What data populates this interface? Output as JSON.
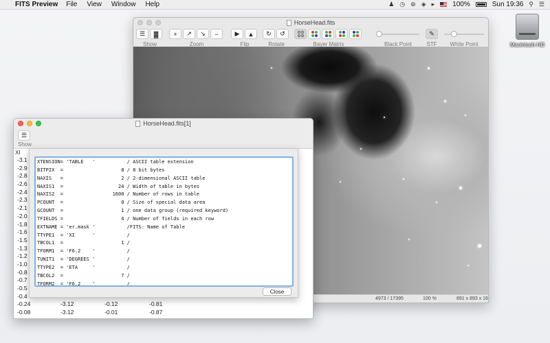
{
  "menubar": {
    "apple_glyph": "",
    "app_name": "FITS Preview",
    "items": [
      "File",
      "View",
      "Window",
      "Help"
    ],
    "battery": "100%",
    "clock": "Sun 19:36"
  },
  "desktop": {
    "disk_label": "Macintosh HD"
  },
  "main_window": {
    "title": "HorseHead.fits",
    "toolbar_labels": {
      "show": "Show",
      "zoom": "Zoom",
      "flip": "Flip",
      "rotate": "Rotate",
      "bayer_matrix": "Bayer Matrix",
      "black_point": "Black Point",
      "stf": "STF",
      "white_point": "White Point"
    },
    "black_point_level": 0.05,
    "white_point_level": 0.25,
    "status": {
      "pixel_value": "4973 / 17395",
      "zoom": "100 %",
      "dimensions": "891 x 893 x 16"
    }
  },
  "table_window": {
    "title": "HorseHead.fits[1]",
    "show_label": "Show",
    "column_header": "XI",
    "rows": [
      [
        "-3.1",
        "",
        "",
        ""
      ],
      [
        "-2.9",
        "",
        "",
        ""
      ],
      [
        "-2.8",
        "",
        "",
        ""
      ],
      [
        "-2.6",
        "",
        "",
        ""
      ],
      [
        "-2.4",
        "",
        "",
        ""
      ],
      [
        "-2.3",
        "",
        "",
        ""
      ],
      [
        "-2.1",
        "",
        "",
        ""
      ],
      [
        "-2.0",
        "",
        "",
        ""
      ],
      [
        "-1.8",
        "",
        "",
        ""
      ],
      [
        "-1.6",
        "",
        "",
        ""
      ],
      [
        "-1.5",
        "",
        "",
        ""
      ],
      [
        "-1.3",
        "",
        "",
        ""
      ],
      [
        "-1.2",
        "",
        "",
        ""
      ],
      [
        "-1.0",
        "",
        "",
        ""
      ],
      [
        "-0.8",
        "",
        "",
        ""
      ],
      [
        "-0.7",
        "",
        "",
        ""
      ],
      [
        "-0.5",
        "",
        "",
        ""
      ],
      [
        "-0.4",
        "",
        "",
        ""
      ],
      [
        "-0.24",
        "-3.12",
        "-0.12",
        "-0.81"
      ],
      [
        "-0.08",
        "-3.12",
        "-0.01",
        "-0.87"
      ]
    ]
  },
  "header_sheet": {
    "lines": [
      "XTENSION= 'TABLE   '           / ASCII table extension",
      "BITPIX  =                    8 / 8 bit bytes",
      "NAXIS   =                    2 / 2-dimensional ASCII table",
      "NAXIS1  =                   24 / Width of table in bytes",
      "NAXIS2  =                 1600 / Number of rows in table",
      "PCOUNT  =                    0 / Size of special data area",
      "GCOUNT  =                    1 / one data group (required keyword)",
      "TFIELDS =                    4 / Number of fields in each row",
      "EXTNAME = 'er.mask '           /FITS: Name of Table",
      "TTYPE1  = 'XI      '           /",
      "TBCOL1  =                    1 /",
      "TFORM1  = 'F6.2    '           /",
      "TUNIT1  = 'DEGREES '           /",
      "TTYPE2  = 'ETA     '           /",
      "TBCOL2  =                    7 /",
      "TFORM2  = 'F6.2    '           /"
    ],
    "close_label": "Close"
  },
  "colors": {
    "accent_focus": "#7fb0e6",
    "traffic_red": "#fc605c",
    "traffic_yellow": "#fdbc40",
    "traffic_green": "#34c84a"
  }
}
